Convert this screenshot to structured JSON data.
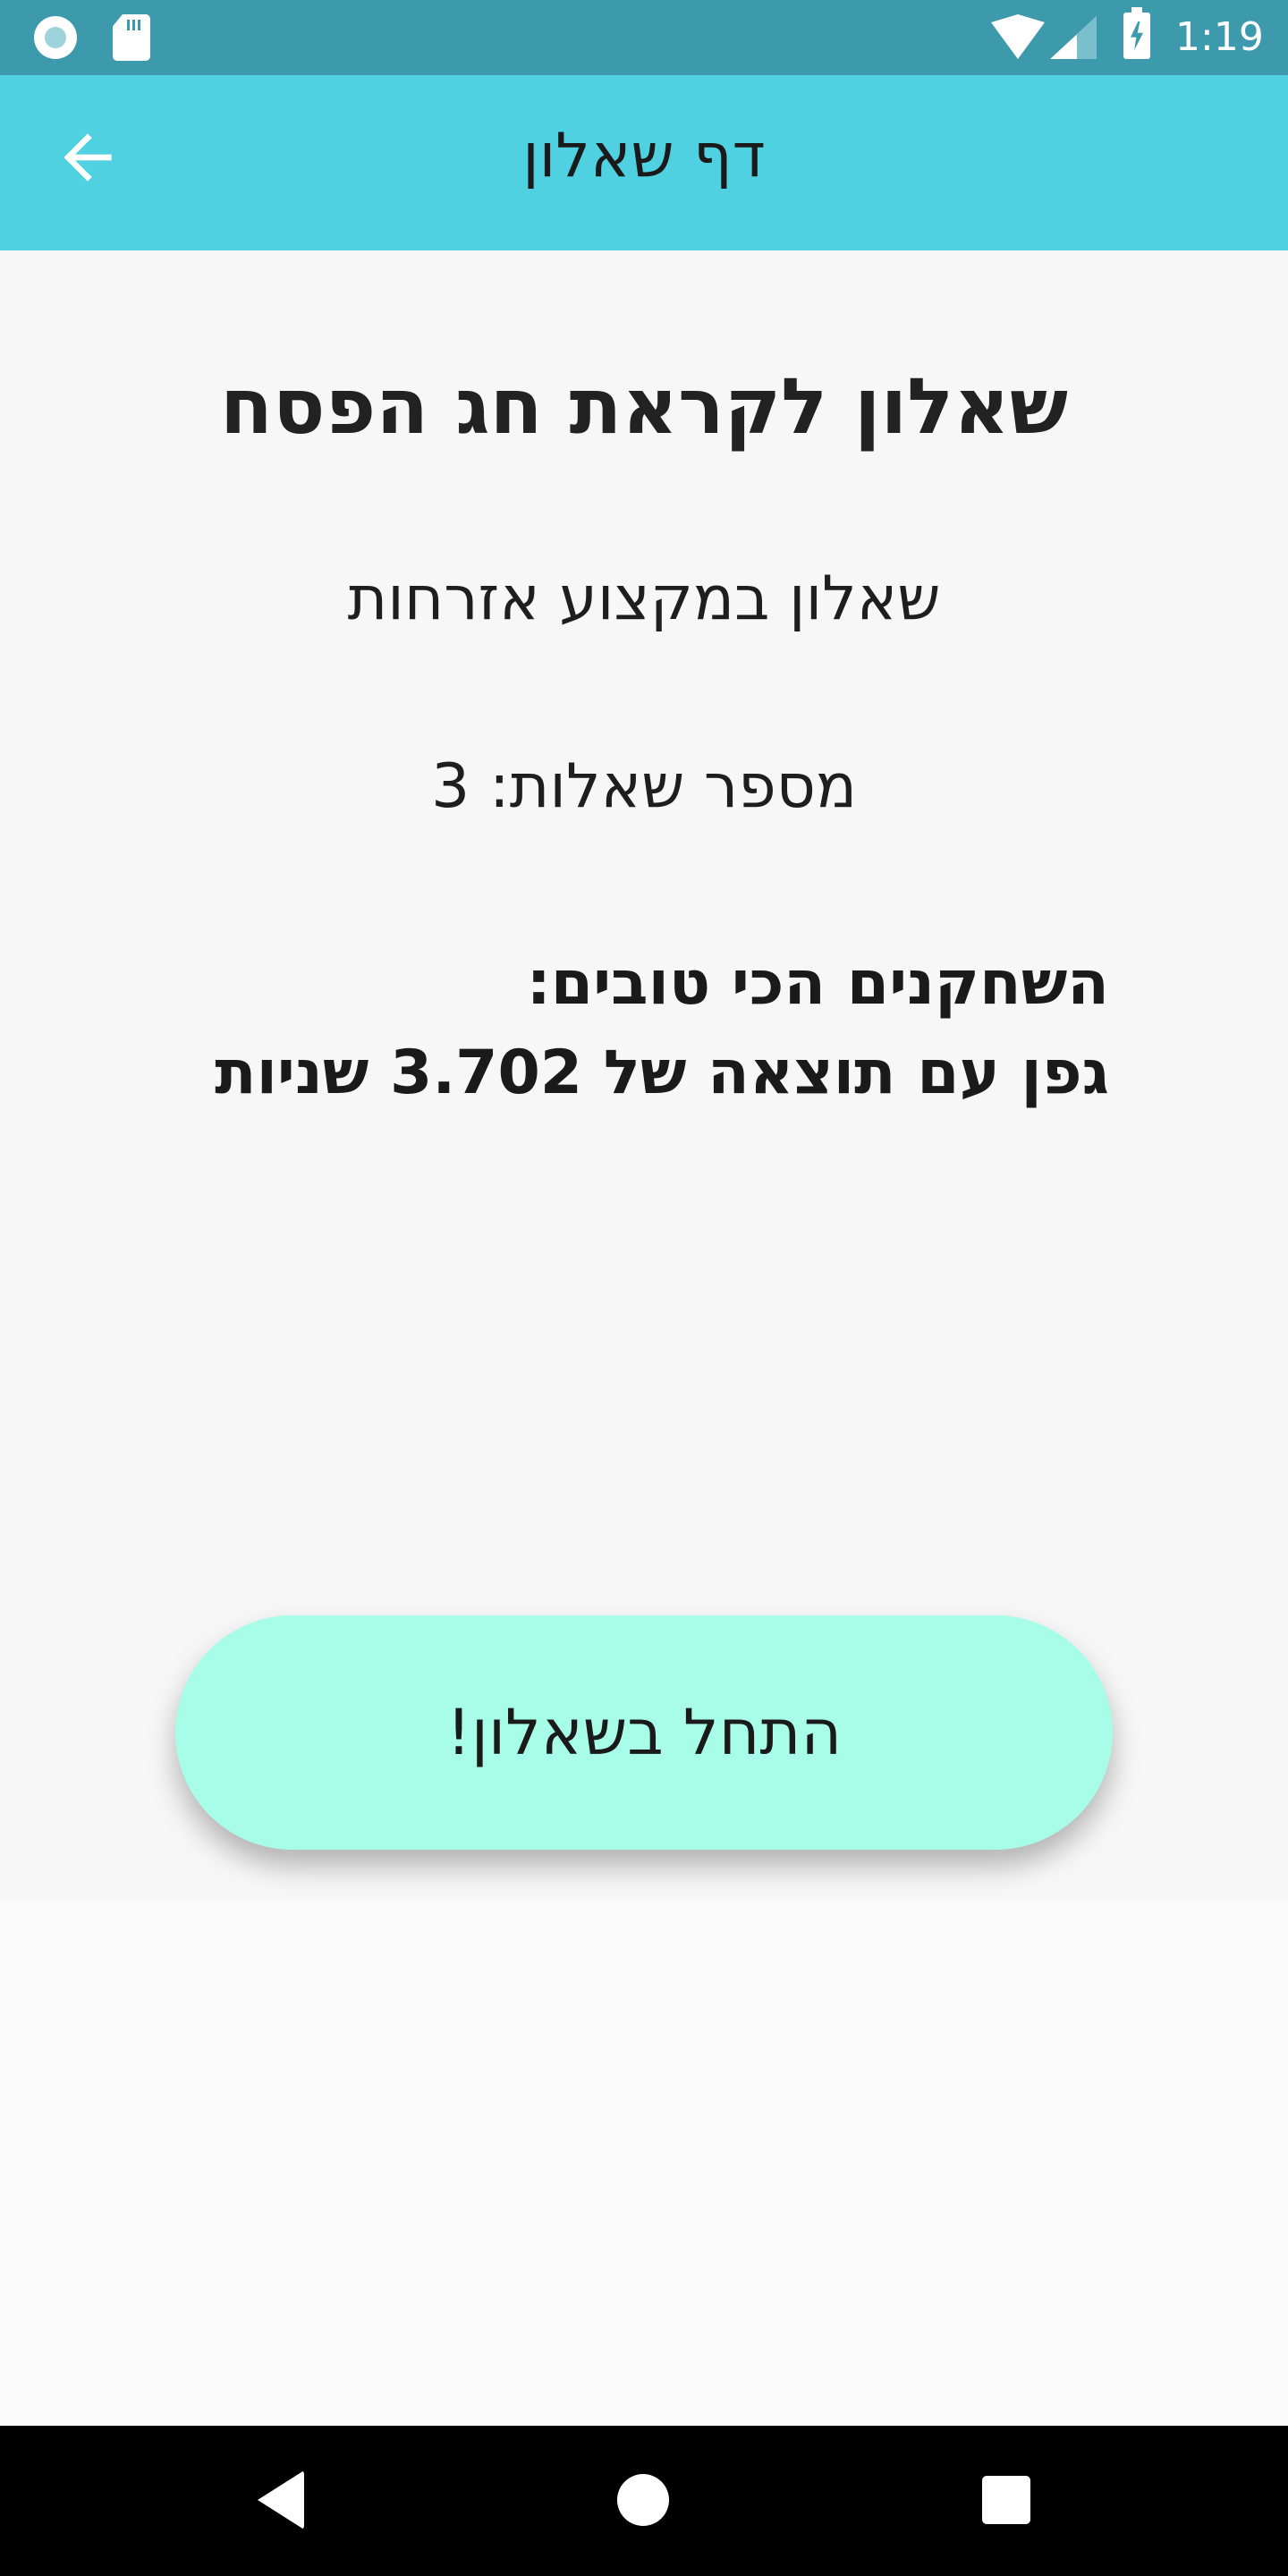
{
  "status_bar": {
    "time": "1:19",
    "icons": [
      "circle-notification-icon",
      "sd-card-icon",
      "wifi-icon",
      "cell-signal-icon",
      "battery-charging-icon"
    ],
    "background_color": "#3d9aac"
  },
  "app_bar": {
    "title": "דף שאלון",
    "back_icon": "arrow-back-icon",
    "background_color": "#4fd1e2"
  },
  "quiz": {
    "title": "שאלון לקראת חג הפסח",
    "subject": "שאלון במקצוע אזרחות",
    "question_count": "מספר שאלות: 3",
    "best_players_heading": "השחקנים הכי טובים:",
    "best_player_line": "גפן עם תוצאה של 3.702 שניות"
  },
  "start_button": {
    "label": "התחל בשאלון!",
    "color": "#a7fde8"
  },
  "nav_bar": {
    "icons": [
      "nav-back-icon",
      "nav-home-icon",
      "nav-recents-icon"
    ]
  }
}
